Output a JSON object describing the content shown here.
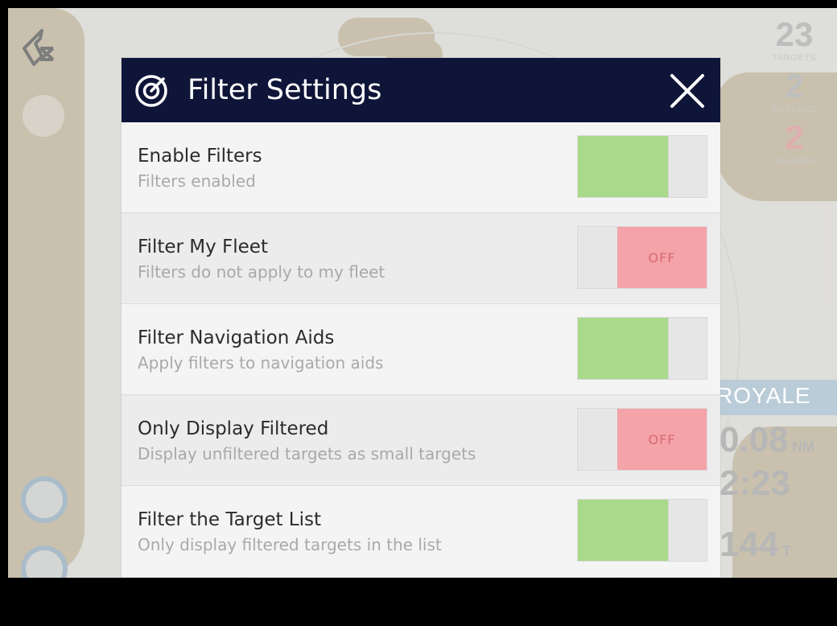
{
  "background": {
    "stats": [
      {
        "value": "23",
        "label": "TARGETS"
      },
      {
        "value": "2",
        "label": "FILTERED"
      },
      {
        "value": "2",
        "label": "ALARMS"
      }
    ],
    "vessel_name": "ROYALE",
    "range": {
      "value": "0.08",
      "unit": "NM"
    },
    "time": "2:23",
    "bearing": {
      "value": "144",
      "unit": "T"
    }
  },
  "dialog": {
    "title": "Filter Settings",
    "settings": [
      {
        "title": "Enable Filters",
        "subtitle": "Filters enabled",
        "on": true,
        "off_label": ""
      },
      {
        "title": "Filter My Fleet",
        "subtitle": "Filters do not apply to my fleet",
        "on": false,
        "off_label": "OFF"
      },
      {
        "title": "Filter Navigation Aids",
        "subtitle": "Apply filters to navigation aids",
        "on": true,
        "off_label": ""
      },
      {
        "title": "Only Display Filtered",
        "subtitle": "Display unfiltered targets as small targets",
        "on": false,
        "off_label": "OFF"
      },
      {
        "title": "Filter the Target List",
        "subtitle": "Only display filtered targets in the list",
        "on": true,
        "off_label": ""
      }
    ]
  },
  "colors": {
    "header_bg": "#0f1538",
    "toggle_on": "#a9d98a",
    "toggle_off": "#f4a3a8",
    "alarm": "#c0392b"
  },
  "icons": {
    "header": "target-radar-icon",
    "close": "close-icon",
    "compass": "north-arrow-icon"
  }
}
